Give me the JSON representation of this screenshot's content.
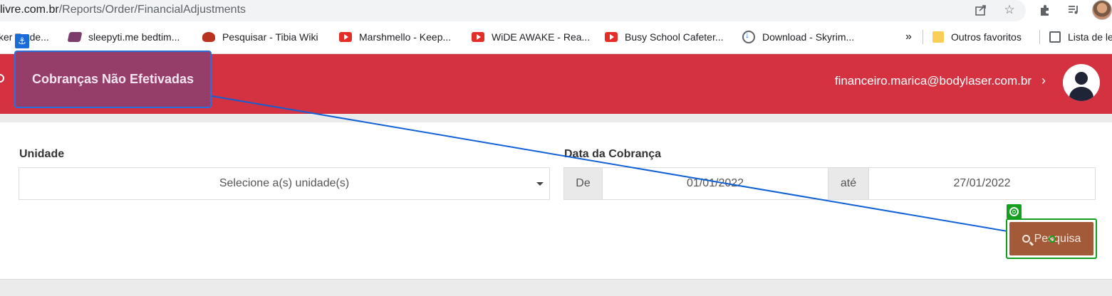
{
  "browser": {
    "url_host": "livre.com.br",
    "url_path": "/Reports/Order/FinancialAdjustments",
    "icons": [
      "share-icon",
      "star-icon",
      "extensions-icon",
      "media-icon",
      "profile-avatar"
    ]
  },
  "bookmarks": {
    "items": [
      {
        "label": "ker Trade...",
        "icon": "bookmark-icon"
      },
      {
        "label": "sleepyti.me bedtim...",
        "icon": "sleepytime-icon"
      },
      {
        "label": "Pesquisar - Tibia Wiki",
        "icon": "tibia-icon"
      },
      {
        "label": "Marshmello - Keep...",
        "icon": "youtube-icon"
      },
      {
        "label": "WiDE AWAKE - Rea...",
        "icon": "youtube-icon"
      },
      {
        "label": "Busy School Cafeter...",
        "icon": "youtube-icon"
      },
      {
        "label": "Download - Skyrim...",
        "icon": "download-icon"
      }
    ],
    "overflow": "»",
    "other_favorites": "Outros favoritos",
    "reading_list": "Lista de le"
  },
  "header": {
    "title": "Cobranças Não Efetivadas",
    "user_email": "financeiro.marica@bodylaser.com.br",
    "chevron": "›",
    "brand_color": "#d43240"
  },
  "filters": {
    "unit_label": "Unidade",
    "unit_placeholder": "Selecione a(s) unidade(s)",
    "date_label": "Data da Cobrança",
    "from_label": "De",
    "from_value": "01/01/2022",
    "to_label": "até",
    "to_value": "27/01/2022"
  },
  "actions": {
    "search_label": "Pesquisa",
    "search_color": "#a35a38"
  },
  "annotation": {
    "anchor_icon": "⚓",
    "line_color": "#1060d6",
    "target_color": "#14a01e"
  }
}
